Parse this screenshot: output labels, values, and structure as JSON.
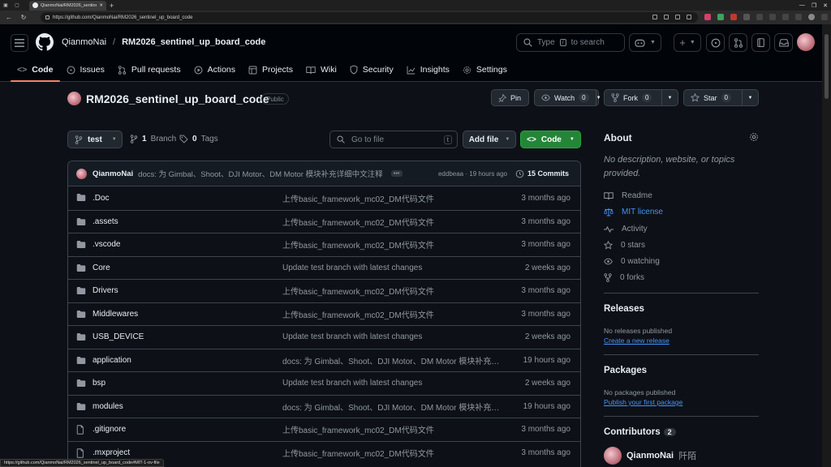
{
  "browser": {
    "tab_title": "QianmoNai/RM2026_sentinel_...",
    "url": "https://github.com/QianmoNai/RM2026_sentinel_up_board_code",
    "status_url": "https://github.com/QianmoNai/RM2026_sentinel_up_board_code#MIT-1-ov-file"
  },
  "header": {
    "owner": "QianmoNai",
    "separator": "/",
    "repo": "RM2026_sentinel_up_board_code",
    "search_prefix": "Type",
    "search_key": "/",
    "search_suffix": "to search"
  },
  "repo_tabs": [
    {
      "label": "Code",
      "icon": "code-icon"
    },
    {
      "label": "Issues",
      "icon": "issue-opened-icon"
    },
    {
      "label": "Pull requests",
      "icon": "pull-request-icon"
    },
    {
      "label": "Actions",
      "icon": "play-icon"
    },
    {
      "label": "Projects",
      "icon": "table-icon"
    },
    {
      "label": "Wiki",
      "icon": "book-icon"
    },
    {
      "label": "Security",
      "icon": "shield-icon"
    },
    {
      "label": "Insights",
      "icon": "graph-icon"
    },
    {
      "label": "Settings",
      "icon": "gear-icon"
    }
  ],
  "repo_head": {
    "title": "RM2026_sentinel_up_board_code",
    "visibility": "Public",
    "pin_label": "Pin",
    "watch_label": "Watch",
    "watch_count": "0",
    "fork_label": "Fork",
    "fork_count": "0",
    "star_label": "Star",
    "star_count": "0"
  },
  "toolbar": {
    "branch": "test",
    "branch_count": "1",
    "branch_label": "Branch",
    "tag_count": "0",
    "tag_label": "Tags",
    "goto_placeholder": "Go to file",
    "goto_key": "t",
    "add_file": "Add file",
    "code": "Code"
  },
  "commit": {
    "author": "QianmoNai",
    "message": "docs: 为 Gimbal、Shoot、DJI Motor、DM Motor 模块补充详细中文注释",
    "ellipsis": "•••",
    "sha": "eddbeaa",
    "sep": "·",
    "time": "19 hours ago",
    "count_label": "15 Commits"
  },
  "files": [
    {
      "name": ".Doc",
      "type": "dir",
      "message": "上传basic_framework_mc02_DM代码文件",
      "date": "3 months ago"
    },
    {
      "name": ".assets",
      "type": "dir",
      "message": "上传basic_framework_mc02_DM代码文件",
      "date": "3 months ago"
    },
    {
      "name": ".vscode",
      "type": "dir",
      "message": "上传basic_framework_mc02_DM代码文件",
      "date": "3 months ago"
    },
    {
      "name": "Core",
      "type": "dir",
      "message": "Update test branch with latest changes",
      "date": "2 weeks ago"
    },
    {
      "name": "Drivers",
      "type": "dir",
      "message": "上传basic_framework_mc02_DM代码文件",
      "date": "3 months ago"
    },
    {
      "name": "Middlewares",
      "type": "dir",
      "message": "上传basic_framework_mc02_DM代码文件",
      "date": "3 months ago"
    },
    {
      "name": "USB_DEVICE",
      "type": "dir",
      "message": "Update test branch with latest changes",
      "date": "2 weeks ago"
    },
    {
      "name": "application",
      "type": "dir",
      "message": "docs: 为 Gimbal、Shoot、DJI Motor、DM Motor 模块补充详...",
      "date": "19 hours ago"
    },
    {
      "name": "bsp",
      "type": "dir",
      "message": "Update test branch with latest changes",
      "date": "2 weeks ago"
    },
    {
      "name": "modules",
      "type": "dir",
      "message": "docs: 为 Gimbal、Shoot、DJI Motor、DM Motor 模块补充详...",
      "date": "19 hours ago"
    },
    {
      "name": ".gitignore",
      "type": "file",
      "message": "上传basic_framework_mc02_DM代码文件",
      "date": "3 months ago"
    },
    {
      "name": ".mxproject",
      "type": "file",
      "message": "上传basic_framework_mc02_DM代码文件",
      "date": "3 months ago"
    }
  ],
  "about": {
    "title": "About",
    "description": "No description, website, or topics provided.",
    "readme": "Readme",
    "license": "MIT license",
    "activity": "Activity",
    "stars": "0 stars",
    "watching": "0 watching",
    "forks": "0 forks"
  },
  "releases": {
    "title": "Releases",
    "none": "No releases published",
    "create": "Create a new release"
  },
  "packages": {
    "title": "Packages",
    "none": "No packages published",
    "publish": "Publish your first package"
  },
  "contributors": {
    "title": "Contributors",
    "count": "2",
    "first_login": "QianmoNai",
    "first_name": "阡陌"
  },
  "colors": {
    "accent_tab": "#f78166",
    "code_button": "#238636",
    "link": "#4493f8",
    "bg": "#0d1117"
  }
}
